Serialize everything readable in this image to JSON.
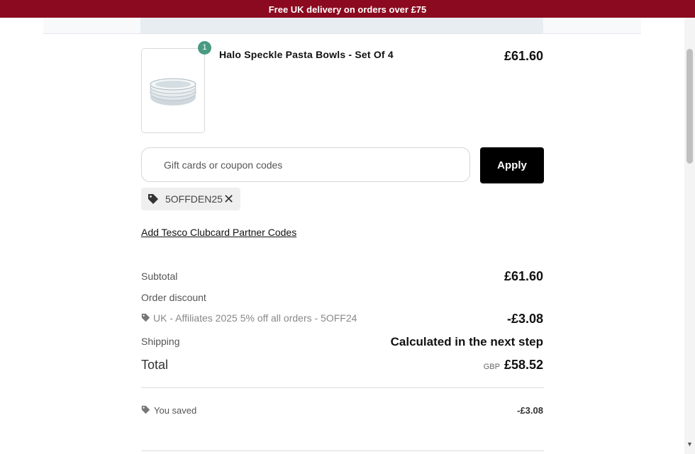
{
  "banner": {
    "text": "Free UK delivery on orders over £75"
  },
  "cart": {
    "items": [
      {
        "name": "Halo Speckle Pasta Bowls - Set Of 4",
        "price": "£61.60",
        "quantity": "1"
      }
    ]
  },
  "coupon": {
    "placeholder": "Gift cards or coupon codes",
    "apply_label": "Apply"
  },
  "applied_code": {
    "code": "5OFFDEN25",
    "remove_icon": "close-icon"
  },
  "clubcard_link": "Add Tesco Clubcard Partner Codes",
  "summary": {
    "subtotal_label": "Subtotal",
    "subtotal_value": "£61.60",
    "order_discount_label": "Order discount",
    "discount_name": "UK - Affiliates 2025 5% off all orders - 5OFF24",
    "discount_value": "-£3.08",
    "shipping_label": "Shipping",
    "shipping_value": "Calculated in the next step",
    "total_label": "Total",
    "total_currency": "GBP",
    "total_value": "£58.52",
    "saved_label": "You saved",
    "saved_value": "-£3.08"
  },
  "colors": {
    "banner": "#8b0a1f",
    "quantity_badge": "#4a9a82",
    "apply_button": "#000000"
  },
  "icons": {
    "tag": "tag-icon",
    "close": "close-icon"
  }
}
